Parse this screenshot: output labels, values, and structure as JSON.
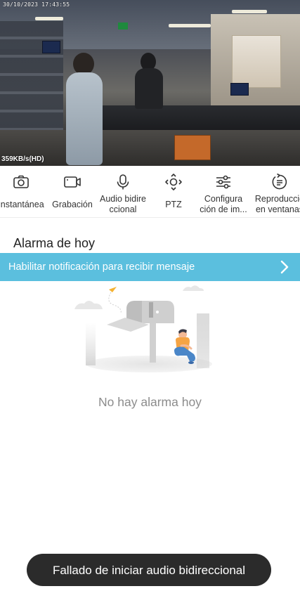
{
  "video": {
    "timestamp": "30/10/2023 17:43:55",
    "bitrate": "359KB/s(HD)"
  },
  "toolbar": {
    "items": [
      {
        "label": "Instantánea",
        "icon": "camera-icon"
      },
      {
        "label": "Grabación",
        "icon": "video-camera-icon"
      },
      {
        "label_line1": "Audio bidire",
        "label_line2": "ccional",
        "icon": "microphone-icon"
      },
      {
        "label": "PTZ",
        "icon": "ptz-icon"
      },
      {
        "label_line1": "Configura",
        "label_line2": "ción de im...",
        "icon": "settings-sliders-icon"
      },
      {
        "label_line1": "Reproducció",
        "label_line2": "en ventanas",
        "icon": "playback-icon"
      }
    ]
  },
  "alarm": {
    "title": "Alarma de hoy",
    "notify_text": "Habilitar notificación para recibir mensaje",
    "empty_text": "No hay alarma hoy"
  },
  "toast": {
    "text": "Fallado de iniciar audio bidireccional"
  },
  "colors": {
    "accent": "#5bbfde",
    "toast_bg": "#2b2b2b",
    "figure_shirt": "#f5a444",
    "figure_pants": "#4a86c8"
  }
}
